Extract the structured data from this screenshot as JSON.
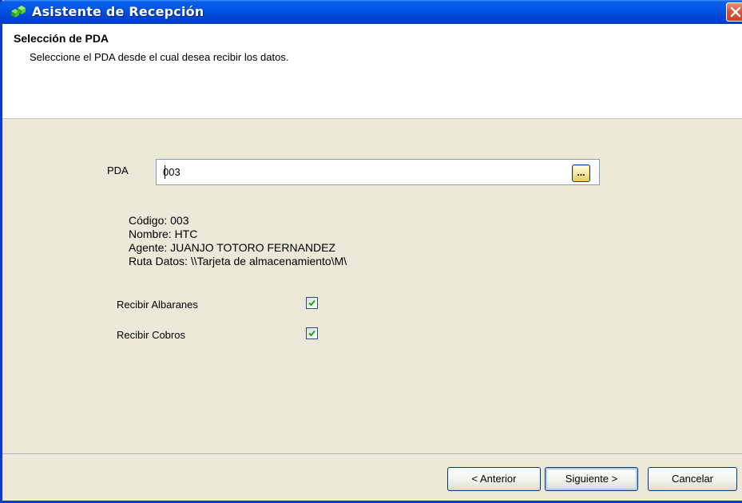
{
  "window": {
    "title": "Asistente de Recepción"
  },
  "header": {
    "title": "Selección de PDA",
    "subtitle": "Seleccione el PDA desde el cual desea recibir los datos."
  },
  "pda": {
    "label": "PDA",
    "value": "003",
    "browse_label": "..."
  },
  "info": {
    "codigo": "Código: 003",
    "nombre": "Nombre: HTC",
    "agente": "Agente: JUANJO TOTORO FERNANDEZ",
    "ruta": "Ruta Datos: \\\\Tarjeta de almacenamiento\\M\\"
  },
  "options": {
    "albaranes": {
      "label": "Recibir Albaranes",
      "checked": true
    },
    "cobros": {
      "label": "Recibir Cobros",
      "checked": true
    }
  },
  "footer": {
    "back_label": "< Anterior",
    "next_label": "Siguiente >",
    "cancel_label": "Cancelar"
  },
  "icons": {
    "app": "green-cubes-icon",
    "close": "close-icon",
    "check": "checkmark-icon"
  },
  "colors": {
    "titlebar": "#0055e5",
    "dialog_bg": "#ece9d8",
    "close_button": "#dc5a3a",
    "checkmark": "#21a121"
  }
}
